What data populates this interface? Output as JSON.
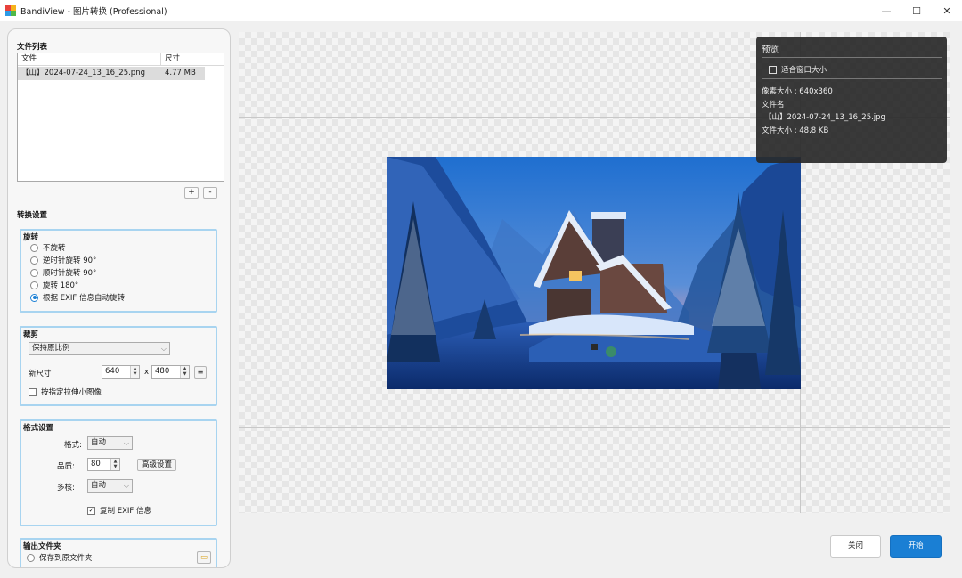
{
  "window": {
    "title": "BandiView - 图片转换 (Professional)",
    "controls": {
      "minimize": "—",
      "maximize": "☐",
      "close": "✕"
    }
  },
  "file_list": {
    "section_title": "文件列表",
    "columns": [
      "文件",
      "尺寸"
    ],
    "rows": [
      {
        "name": "【山】2024-07-24_13_16_25.png",
        "size": "4.77 MB"
      }
    ],
    "add_label": "+",
    "remove_label": "-"
  },
  "convert_settings": {
    "section_title": "转换设置",
    "rotate": {
      "title": "旋转",
      "options": [
        "不旋转",
        "逆时针旋转 90°",
        "顺时针旋转 90°",
        "旋转 180°",
        "根据 EXIF 信息自动旋转"
      ],
      "selected_index": 4
    },
    "crop": {
      "title": "裁剪",
      "mode": "保持原比例",
      "new_size_label": "新尺寸",
      "width": "640",
      "x_label": "x",
      "height": "480",
      "stretch_label": "按指定拉伸小图像",
      "stretch_checked": false
    },
    "format": {
      "title": "格式设置",
      "format_label": "格式:",
      "format_value": "自动",
      "quality_label": "品质:",
      "quality_value": "80",
      "advanced_label": "高级设置",
      "multicore_label": "多核:",
      "multicore_value": "自动",
      "copy_exif_label": "复制 EXIF 信息",
      "copy_exif_checked": true
    },
    "output": {
      "title": "输出文件夹",
      "save_original_label": "保存到原文件夹"
    }
  },
  "preview": {
    "title": "预览",
    "fit_window_label": "适合窗口大小",
    "pixel_size": "像素大小 : 640x360",
    "filename_label": "文件名",
    "filename": "【山】2024-07-24_13_16_25.jpg",
    "file_size": "文件大小 : 48.8 KB"
  },
  "actions": {
    "close_label": "关闭",
    "start_label": "开始"
  },
  "colors": {
    "accent": "#1a7fd4",
    "group_border": "#a8d4f0"
  }
}
